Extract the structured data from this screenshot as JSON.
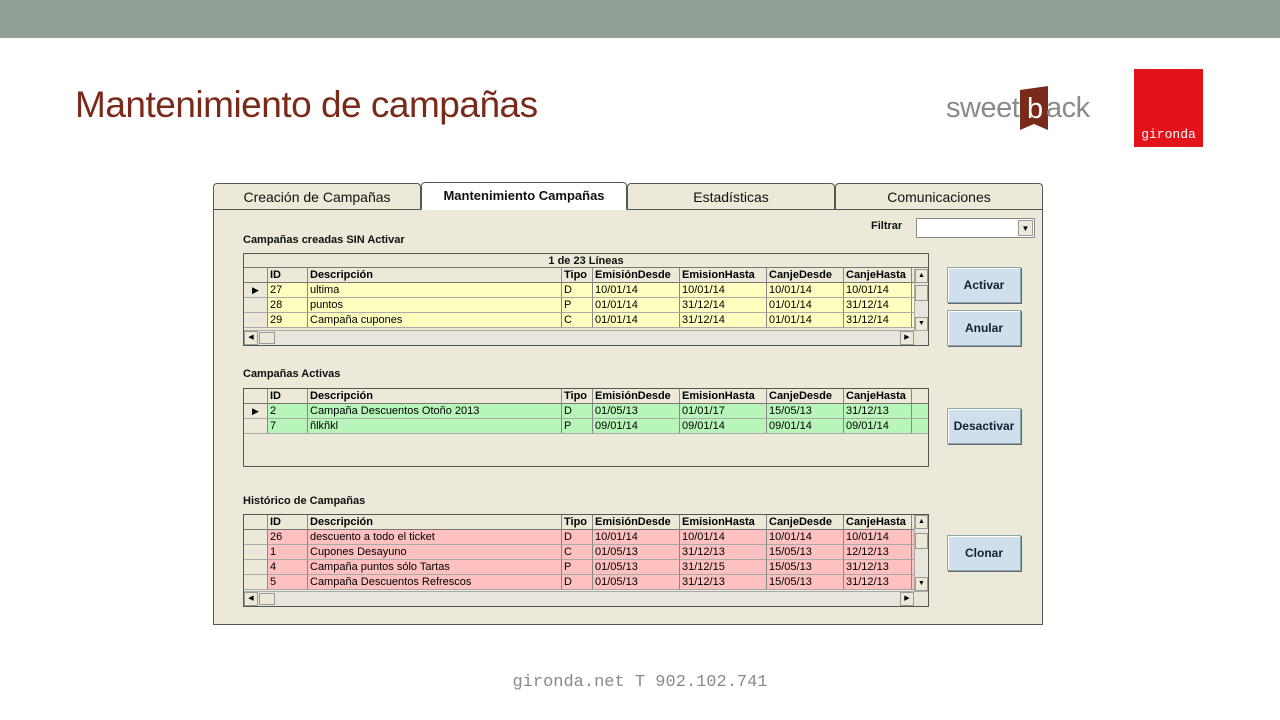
{
  "slide": {
    "title": "Mantenimiento de campañas",
    "footer": "gironda.net T 902.102.741"
  },
  "logos": {
    "sweetback_left": "sweet",
    "sweetback_letter": "b",
    "sweetback_right": "ack",
    "gironda": "gironda"
  },
  "tabs": [
    {
      "label": "Creación de Campañas"
    },
    {
      "label": "Mantenimiento Campañas",
      "active": true
    },
    {
      "label": "Estadísticas"
    },
    {
      "label": "Comunicaciones"
    }
  ],
  "filter": {
    "label": "Filtrar",
    "value": ""
  },
  "columns": [
    "ID",
    "Descripción",
    "Tipo",
    "EmisiónDesde",
    "EmisionHasta",
    "CanjeDesde",
    "CanjeHasta"
  ],
  "inactive": {
    "title": "Campañas creadas SIN Activar",
    "caption": "1 de 23 Líneas",
    "rows": [
      {
        "id": "27",
        "desc": "ultima",
        "tipo": "D",
        "ed": "10/01/14",
        "eh": "10/01/14",
        "cd": "10/01/14",
        "ch": "10/01/14",
        "selected": true
      },
      {
        "id": "28",
        "desc": "puntos",
        "tipo": "P",
        "ed": "01/01/14",
        "eh": "31/12/14",
        "cd": "01/01/14",
        "ch": "31/12/14"
      },
      {
        "id": "29",
        "desc": "Campaña cupones",
        "tipo": "C",
        "ed": "01/01/14",
        "eh": "31/12/14",
        "cd": "01/01/14",
        "ch": "31/12/14"
      }
    ]
  },
  "active": {
    "title": "Campañas Activas",
    "rows": [
      {
        "id": "2",
        "desc": "Campaña Descuentos Otoño 2013",
        "tipo": "D",
        "ed": "01/05/13",
        "eh": "01/01/17",
        "cd": "15/05/13",
        "ch": "31/12/13",
        "selected": true
      },
      {
        "id": "7",
        "desc": "ñlkñkl",
        "tipo": "P",
        "ed": "09/01/14",
        "eh": "09/01/14",
        "cd": "09/01/14",
        "ch": "09/01/14"
      }
    ]
  },
  "history": {
    "title": "Histórico de Campañas",
    "rows": [
      {
        "id": "26",
        "desc": "descuento a todo el ticket",
        "tipo": "D",
        "ed": "10/01/14",
        "eh": "10/01/14",
        "cd": "10/01/14",
        "ch": "10/01/14"
      },
      {
        "id": "1",
        "desc": "Cupones Desayuno",
        "tipo": "C",
        "ed": "01/05/13",
        "eh": "31/12/13",
        "cd": "15/05/13",
        "ch": "12/12/13"
      },
      {
        "id": "4",
        "desc": "Campaña puntos sólo Tartas",
        "tipo": "P",
        "ed": "01/05/13",
        "eh": "31/12/15",
        "cd": "15/05/13",
        "ch": "31/12/13"
      },
      {
        "id": "5",
        "desc": "Campaña Descuentos Refrescos",
        "tipo": "D",
        "ed": "01/05/13",
        "eh": "31/12/13",
        "cd": "15/05/13",
        "ch": "31/12/13"
      }
    ]
  },
  "buttons": {
    "activar": "Activar",
    "anular": "Anular",
    "desactivar": "Desactivar",
    "clonar": "Clonar"
  },
  "colors": {
    "title": "#7a2a1a",
    "top_bar": "#919f96",
    "row_inactive": "#ffffc0",
    "row_active": "#b8f5b8",
    "row_history": "#ffc0c0",
    "gironda_red": "#e3121b",
    "sweetback_flag": "#7a2a1a"
  }
}
